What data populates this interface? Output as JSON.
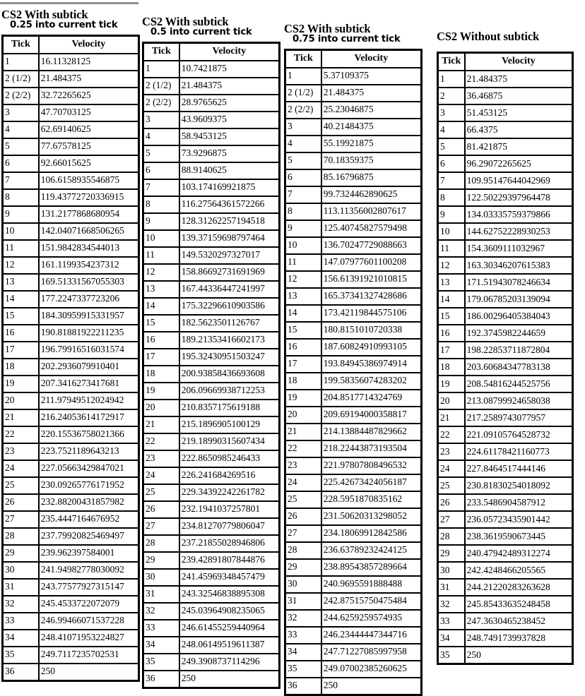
{
  "document": {
    "kind": "velocity-tick-tables",
    "tables": [
      {
        "id": "with-subtick-025",
        "title_main": "CS2 With subtick",
        "title_sub": "0.25 into current tick",
        "columns": [
          "Tick",
          "Velocity"
        ],
        "rows": [
          [
            "1",
            "16.11328125"
          ],
          [
            "2 (1/2)",
            "21.484375"
          ],
          [
            "2 (2/2)",
            "32.72265625"
          ],
          [
            "3",
            "47.70703125"
          ],
          [
            "4",
            "62.69140625"
          ],
          [
            "5",
            "77.67578125"
          ],
          [
            "6",
            "92.66015625"
          ],
          [
            "7",
            "106.6158935546875"
          ],
          [
            "8",
            "119.43772720336915"
          ],
          [
            "9",
            "131.2177868680954"
          ],
          [
            "10",
            "142.04071668506265"
          ],
          [
            "11",
            "151.9842834544013"
          ],
          [
            "12",
            "161.1199354237312"
          ],
          [
            "13",
            "169.51331567055303"
          ],
          [
            "14",
            "177.2247337723206"
          ],
          [
            "15",
            "184.30959915331957"
          ],
          [
            "16",
            "190.81881922211235"
          ],
          [
            "17",
            "196.79916516031574"
          ],
          [
            "18",
            "202.2936079910401"
          ],
          [
            "19",
            "207.3416273417681"
          ],
          [
            "20",
            "211.97949512024942"
          ],
          [
            "21",
            "216.24053614172917"
          ],
          [
            "22",
            "220.15536758021366"
          ],
          [
            "23",
            "223.7521189643213"
          ],
          [
            "24",
            "227.05663429847021"
          ],
          [
            "25",
            "230.09265776171952"
          ],
          [
            "26",
            "232.88200431857982"
          ],
          [
            "27",
            "235.4447164676952"
          ],
          [
            "28",
            "237.79920825469497"
          ],
          [
            "29",
            "239.962397584001"
          ],
          [
            "30",
            "241.94982778030092"
          ],
          [
            "31",
            "243.77577927315147"
          ],
          [
            "32",
            "245.4533722072079"
          ],
          [
            "33",
            "246.99466071537228"
          ],
          [
            "34",
            "248.41071953224827"
          ],
          [
            "35",
            "249.7117235702531"
          ],
          [
            "36",
            "250"
          ]
        ]
      },
      {
        "id": "with-subtick-05",
        "title_main": "CS2 With subtick",
        "title_sub": "0.5 into current tick",
        "columns": [
          "Tick",
          "Velocity"
        ],
        "rows": [
          [
            "1",
            "10.7421875"
          ],
          [
            "2 (1/2)",
            "21.484375"
          ],
          [
            "2 (2/2)",
            "28.9765625"
          ],
          [
            "3",
            "43.9609375"
          ],
          [
            "4",
            "58.9453125"
          ],
          [
            "5",
            "73.9296875"
          ],
          [
            "6",
            "88.9140625"
          ],
          [
            "7",
            "103.174169921875"
          ],
          [
            "8",
            "116.27564361572266"
          ],
          [
            "9",
            "128.31262257194518"
          ],
          [
            "10",
            "139.37159698797464"
          ],
          [
            "11",
            "149.5320297327017"
          ],
          [
            "12",
            "158.86692731691969"
          ],
          [
            "13",
            "167.44336447241997"
          ],
          [
            "14",
            "175.32296610903586"
          ],
          [
            "15",
            "182.5623501126767"
          ],
          [
            "16",
            "189.21353416602173"
          ],
          [
            "17",
            "195.32430951503247"
          ],
          [
            "18",
            "200.93858436693608"
          ],
          [
            "19",
            "206.09669938712253"
          ],
          [
            "20",
            "210.8357175619188"
          ],
          [
            "21",
            "215.1896905100129"
          ],
          [
            "22",
            "219.18990315607434"
          ],
          [
            "23",
            "222.8650985246433"
          ],
          [
            "24",
            "226.241684269516"
          ],
          [
            "25",
            "229.34392242261782"
          ],
          [
            "26",
            "232.1941037257801"
          ],
          [
            "27",
            "234.81270779806047"
          ],
          [
            "28",
            "237.21855028946806"
          ],
          [
            "29",
            "239.42891807844876"
          ],
          [
            "30",
            "241.45969348457479"
          ],
          [
            "31",
            "243.32546838895308"
          ],
          [
            "32",
            "245.03964908235065"
          ],
          [
            "33",
            "246.61455259440964"
          ],
          [
            "34",
            "248.06149519611387"
          ],
          [
            "35",
            "249.3908737114296"
          ],
          [
            "36",
            "250"
          ]
        ]
      },
      {
        "id": "with-subtick-075",
        "title_main": "CS2 With subtick",
        "title_sub": "0.75 into current tick",
        "columns": [
          "Tick",
          "Velocity"
        ],
        "rows": [
          [
            "1",
            "5.37109375"
          ],
          [
            "2 (1/2)",
            "21.484375"
          ],
          [
            "2 (2/2)",
            "25.23046875"
          ],
          [
            "3",
            "40.21484375"
          ],
          [
            "4",
            "55.19921875"
          ],
          [
            "5",
            "70.18359375"
          ],
          [
            "6",
            "85.16796875"
          ],
          [
            "7",
            "99.7324462890625"
          ],
          [
            "8",
            "113.11356002807617"
          ],
          [
            "9",
            "125.40745827579498"
          ],
          [
            "10",
            "136.70247729088663"
          ],
          [
            "11",
            "147.07977601100208"
          ],
          [
            "12",
            "156.61391921010815"
          ],
          [
            "13",
            "165.37341327428686"
          ],
          [
            "14",
            "173.42119844575106"
          ],
          [
            "15",
            "180.8151010720338"
          ],
          [
            "16",
            "187.60824910993105"
          ],
          [
            "17",
            "193.84945386974914"
          ],
          [
            "18",
            "199.58356074283202"
          ],
          [
            "19",
            "204.8517714324769"
          ],
          [
            "20",
            "209.69194000358817"
          ],
          [
            "21",
            "214.13884487829662"
          ],
          [
            "22",
            "218.22443873193504"
          ],
          [
            "23",
            "221.97807808496532"
          ],
          [
            "24",
            "225.42673424056187"
          ],
          [
            "25",
            "228.5951870835162"
          ],
          [
            "26",
            "231.50620313298052"
          ],
          [
            "27",
            "234.18069912842586"
          ],
          [
            "28",
            "236.63789232424125"
          ],
          [
            "29",
            "238.89543857289664"
          ],
          [
            "30",
            "240.9695591888488"
          ],
          [
            "31",
            "242.87515750475484"
          ],
          [
            "32",
            "244.6259259574935"
          ],
          [
            "33",
            "246.23444447344716"
          ],
          [
            "34",
            "247.71227085997958"
          ],
          [
            "35",
            "249.07002385260625"
          ],
          [
            "36",
            "250"
          ]
        ]
      },
      {
        "id": "without-subtick",
        "title_main": "CS2 Without subtick",
        "title_sub": "",
        "columns": [
          "Tick",
          "Velocity"
        ],
        "rows": [
          [
            "1",
            "21.484375"
          ],
          [
            "2",
            "36.46875"
          ],
          [
            "3",
            "51.453125"
          ],
          [
            "4",
            "66.4375"
          ],
          [
            "5",
            "81.421875"
          ],
          [
            "6",
            "96.29072265625"
          ],
          [
            "7",
            "109.95147644042969"
          ],
          [
            "8",
            "122.50229397964478"
          ],
          [
            "9",
            "134.03335759379866"
          ],
          [
            "10",
            "144.62752228930253"
          ],
          [
            "11",
            "154.3609111032967"
          ],
          [
            "12",
            "163.30346207615383"
          ],
          [
            "13",
            "171.51943078246634"
          ],
          [
            "14",
            "179.06785203139094"
          ],
          [
            "15",
            "186.00296405384043"
          ],
          [
            "16",
            "192.3745982244659"
          ],
          [
            "17",
            "198.22853711872804"
          ],
          [
            "18",
            "203.60684347783138"
          ],
          [
            "19",
            "208.54816244525756"
          ],
          [
            "20",
            "213.08799924658038"
          ],
          [
            "21",
            "217.2589743077957"
          ],
          [
            "22",
            "221.09105764528732"
          ],
          [
            "23",
            "224.61178421160773"
          ],
          [
            "24",
            "227.8464517444146"
          ],
          [
            "25",
            "230.81830254018092"
          ],
          [
            "26",
            "233.5486904587912"
          ],
          [
            "27",
            "236.05723435901442"
          ],
          [
            "28",
            "238.3619590673445"
          ],
          [
            "29",
            "240.47942489312274"
          ],
          [
            "30",
            "242.4248466205565"
          ],
          [
            "31",
            "244.21220283263628"
          ],
          [
            "32",
            "245.85433635248458"
          ],
          [
            "33",
            "247.3630465238452"
          ],
          [
            "34",
            "248.7491739937828"
          ],
          [
            "35",
            "250"
          ]
        ]
      }
    ]
  },
  "colors": {
    "background": "#ffffff",
    "text": "#000000",
    "border": "#000000",
    "top_rule": "#8d8d8d"
  }
}
